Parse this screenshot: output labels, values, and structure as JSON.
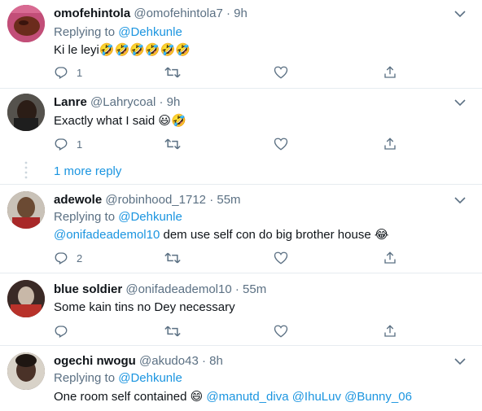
{
  "tweets": [
    {
      "name": "omofehintola",
      "handle": "@omofehintola7",
      "time": "9h",
      "replying_prefix": "Replying to",
      "replying_to": "@Dehkunle",
      "text": "Ki le leyi",
      "emoji": "🤣🤣🤣🤣🤣🤣",
      "reply_count": "1",
      "avatar_color": "#b5436a"
    },
    {
      "name": "Lanre",
      "handle": "@Lahrycoal",
      "time": "9h",
      "text": "Exactly what I said",
      "emoji": "😃🤣",
      "reply_count": "1",
      "avatar_color": "#3c3a38"
    },
    {
      "more_replies": "1 more reply"
    },
    {
      "name": "adewole",
      "handle": "@robinhood_1712",
      "time": "55m",
      "replying_prefix": "Replying to",
      "replying_to": "@Dehkunle",
      "mention": "@onifadeademol10",
      "text": "dem use self con do big brother house",
      "emoji": "😂",
      "reply_count": "2",
      "avatar_color": "#6b4a33"
    },
    {
      "name": "blue soldier",
      "handle": "@onifadeademol10",
      "time": "55m",
      "text": "Some kain tins no Dey necessary",
      "reply_count": "",
      "avatar_color": "#8a2f2a"
    },
    {
      "name": "ogechi nwogu",
      "handle": "@akudo43",
      "time": "8h",
      "replying_prefix": "Replying to",
      "replying_to": "@Dehkunle",
      "text": "One room self contained",
      "emoji": "😄",
      "mentions": "@manutd_diva @IhuLuv @Bunny_06",
      "avatar_color": "#4a3a30"
    }
  ],
  "colors": {
    "accent": "#1b95e0",
    "muted": "#5b7083",
    "divider": "#e6ecf0"
  },
  "icons": [
    "reply-icon",
    "retweet-icon",
    "like-icon",
    "share-icon",
    "chevron-down-icon"
  ]
}
